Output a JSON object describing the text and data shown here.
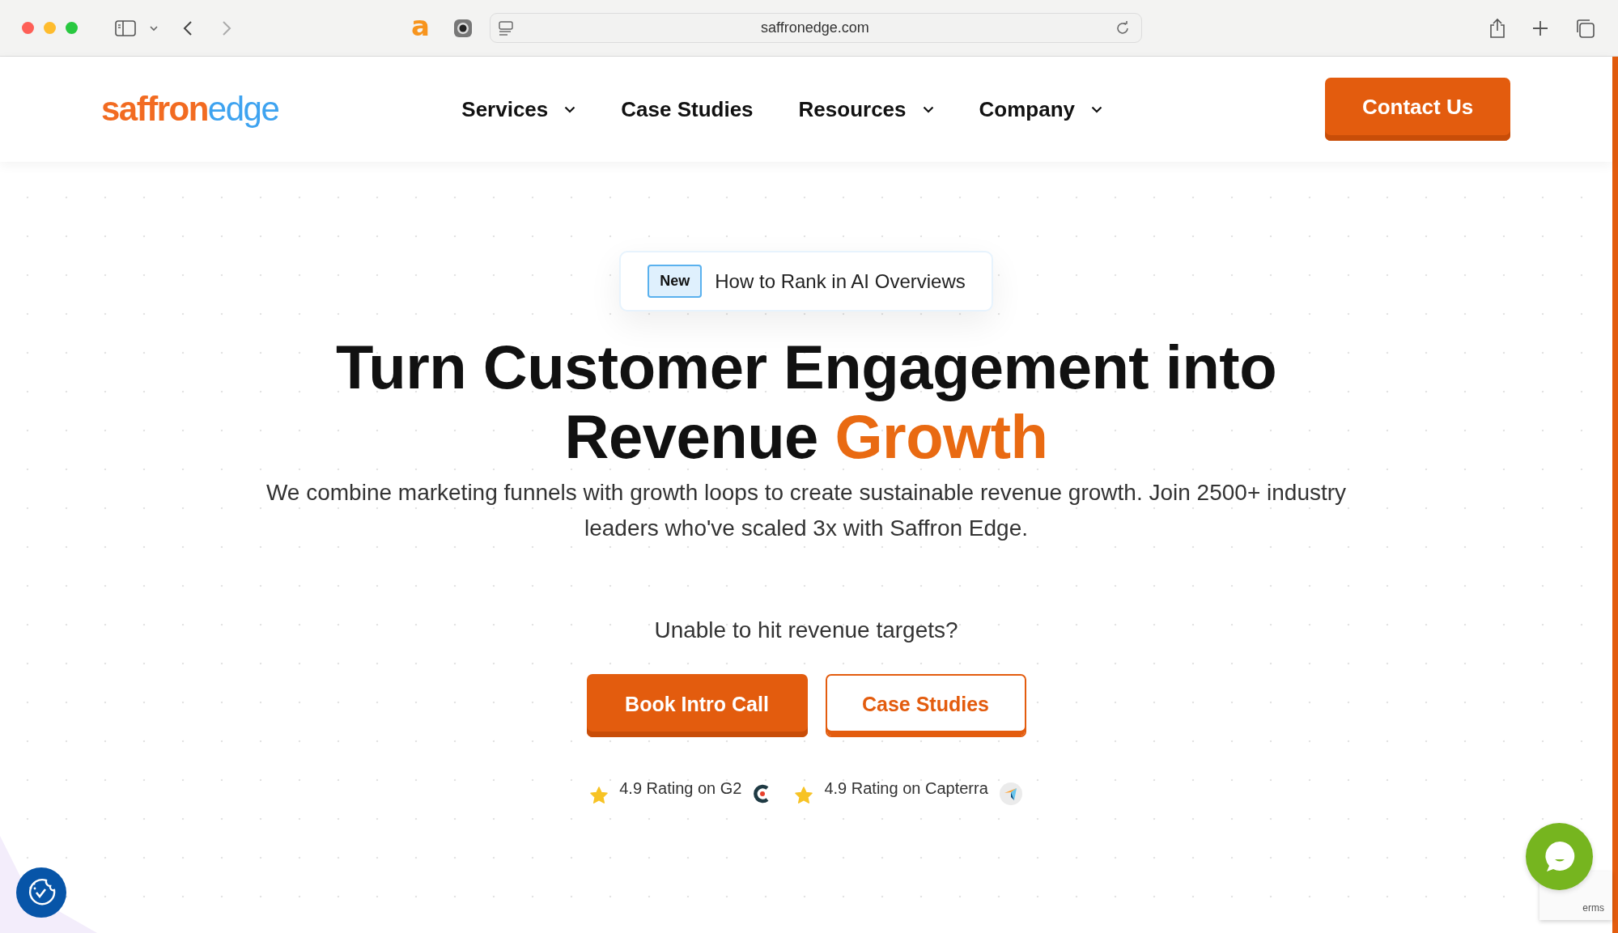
{
  "browser": {
    "url": "saffronedge.com",
    "extension_label": "a"
  },
  "logo": {
    "primary": "saffron",
    "secondary": "edge"
  },
  "nav": {
    "items": [
      {
        "label": "Services",
        "has_dropdown": true
      },
      {
        "label": "Case Studies",
        "has_dropdown": false
      },
      {
        "label": "Resources",
        "has_dropdown": true
      },
      {
        "label": "Company",
        "has_dropdown": true
      }
    ],
    "cta": "Contact Us"
  },
  "announcement": {
    "badge": "New",
    "text": "How to Rank in AI Overviews"
  },
  "headline": {
    "text": "Turn Customer Engagement into Revenue",
    "highlight": "Growth"
  },
  "subheadline": "We combine marketing funnels with growth loops to create sustainable revenue growth. Join 2500+ industry leaders who've scaled 3x with Saffron Edge.",
  "question": "Unable to hit revenue targets?",
  "buttons": [
    {
      "label": "Book Intro Call",
      "kind": "primary"
    },
    {
      "label": "Case Studies",
      "kind": "outline"
    }
  ],
  "ratings": [
    {
      "text": "4.9 Rating on G2",
      "kind": "g2"
    },
    {
      "text": "4.9 Rating on Capterra",
      "kind": "capterra"
    }
  ],
  "recaptcha": {
    "text": "erms"
  }
}
